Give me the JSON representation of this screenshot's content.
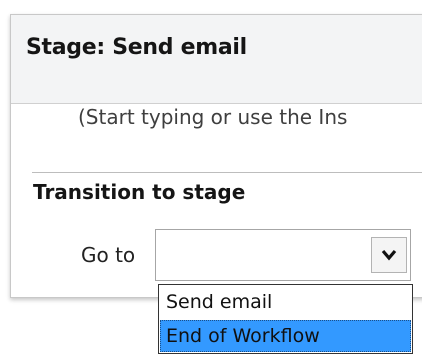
{
  "stage": {
    "title": "Stage: Send email",
    "hint": "(Start typing or use the Ins"
  },
  "transition": {
    "section_title": "Transition to stage",
    "goto_label": "Go to",
    "goto_value": "",
    "options": [
      {
        "label": "Send email",
        "selected": false
      },
      {
        "label": "End of Workflow",
        "selected": true
      }
    ]
  },
  "colors": {
    "header_bg": "#f3f4f5",
    "highlight": "#3399ff",
    "border": "#c8c8c8"
  },
  "icons": {
    "dropdown": "chevron-down-icon"
  }
}
